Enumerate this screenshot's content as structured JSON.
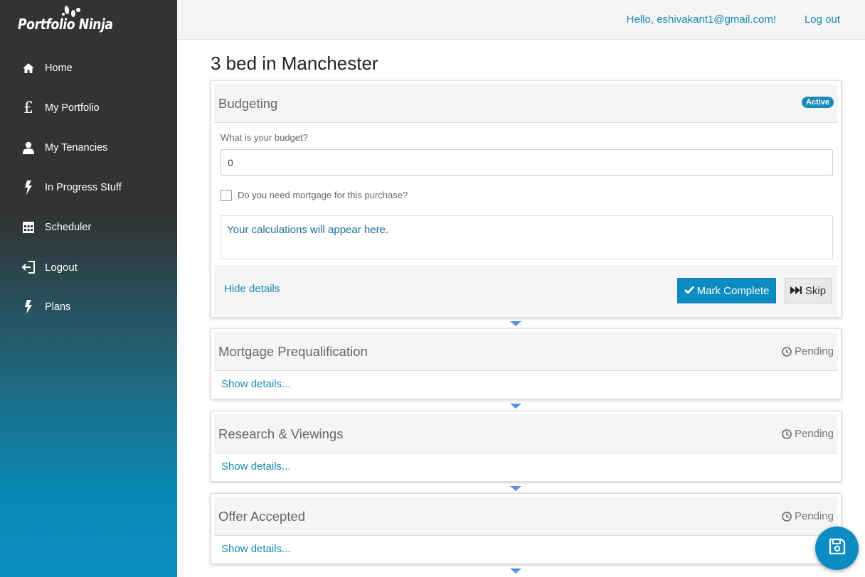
{
  "app": {
    "logo_text": "Portfolio Ninja"
  },
  "sidebar": {
    "items": [
      {
        "label": "Home",
        "icon": "home-icon"
      },
      {
        "label": "My Portfolio",
        "icon": "pound-icon"
      },
      {
        "label": "My Tenancies",
        "icon": "user-icon"
      },
      {
        "label": "In Progress Stuff",
        "icon": "bolt-icon"
      },
      {
        "label": "Scheduler",
        "icon": "calendar-icon"
      },
      {
        "label": "Logout",
        "icon": "sign-out-icon"
      },
      {
        "label": "Plans",
        "icon": "bolt-icon"
      }
    ]
  },
  "header": {
    "greeting": "Hello, eshivakant1@gmail.com!",
    "logout_label": "Log out"
  },
  "page": {
    "title": "3 bed in Manchester"
  },
  "steps": [
    {
      "title": "Budgeting",
      "status": "Active",
      "budget_question": "What is your budget?",
      "budget_value": "0",
      "mortgage_question": "Do you need mortgage for this purchase?",
      "mortgage_checked": false,
      "calculations_placeholder": "Your calculations will appear here.",
      "hide_details_label": "Hide details",
      "mark_complete_label": "Mark Complete",
      "skip_label": "Skip"
    },
    {
      "title": "Mortgage Prequalification",
      "status": "Pending",
      "details_label": "Show details..."
    },
    {
      "title": "Research & Viewings",
      "status": "Pending",
      "details_label": "Show details..."
    },
    {
      "title": "Offer Accepted",
      "status": "Pending",
      "details_label": "Show details..."
    }
  ],
  "colors": {
    "accent": "#0c8cc2",
    "sidebar_dark": "#333333",
    "link": "#1a8bb6"
  },
  "fab": {
    "icon": "floppy-disk-icon"
  }
}
